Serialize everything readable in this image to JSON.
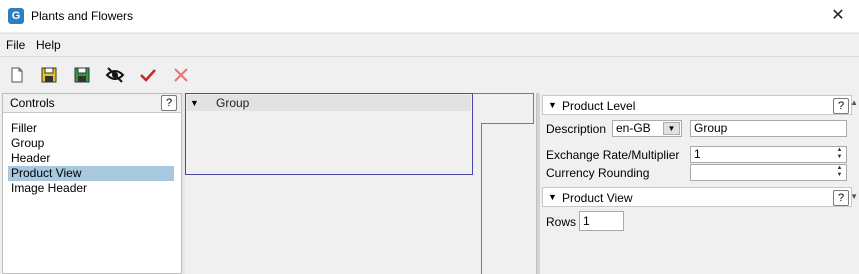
{
  "window": {
    "title": "Plants and Flowers",
    "app_icon": "G"
  },
  "menu": [
    {
      "label": "File"
    },
    {
      "label": "Help"
    }
  ],
  "toolbar": {
    "items": [
      {
        "name": "new-document-icon"
      },
      {
        "name": "save-icon"
      },
      {
        "name": "save-all-icon"
      },
      {
        "name": "hide-eye-icon"
      },
      {
        "name": "checkmark-icon"
      },
      {
        "name": "cross-icon"
      }
    ]
  },
  "controls_panel": {
    "title": "Controls",
    "help": "?",
    "items": [
      "Filler",
      "Group",
      "Header",
      "Product View",
      "Image Header"
    ],
    "selected": "Product View"
  },
  "design": {
    "group_label": "Group"
  },
  "product_level": {
    "title": "Product Level",
    "help": "?",
    "description_label": "Description",
    "language": "en-GB",
    "description_value": "Group",
    "exchange_label": "Exchange Rate/Multiplier",
    "exchange_value": "1",
    "currency_label": "Currency Rounding",
    "currency_value": ""
  },
  "product_view": {
    "title": "Product View",
    "help": "?",
    "rows_label": "Rows",
    "rows_value": "1"
  },
  "colors": {
    "accent": "#2b7fc3",
    "selection": "#a8c8e0",
    "group_border": "#4b4ba3",
    "check": "#c62828",
    "cross": "#e57373"
  }
}
